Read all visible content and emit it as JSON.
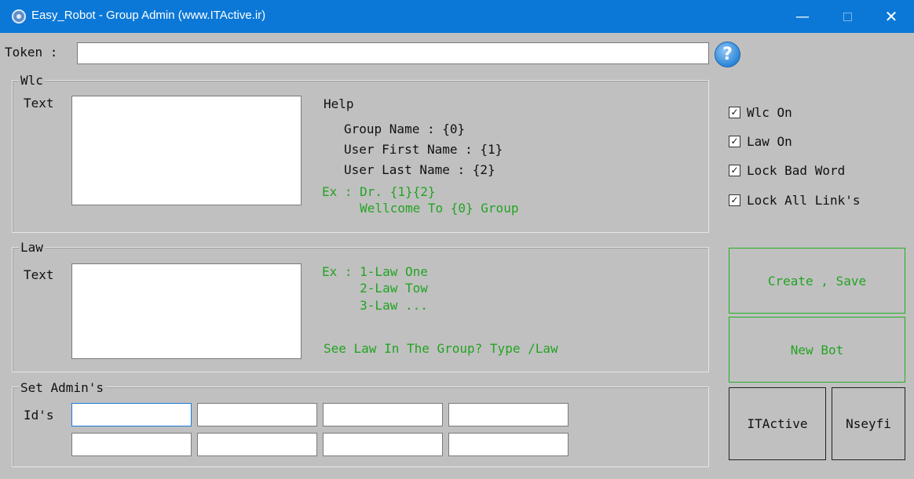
{
  "window": {
    "title": "Easy_Robot - Group Admin (www.ITActive.ir)",
    "minimize": "—",
    "close": "✕"
  },
  "token": {
    "label": "Token :",
    "value": ""
  },
  "help_button": "?",
  "wlc": {
    "title": "Wlc",
    "text_label": "Text",
    "text_value": "",
    "help_title": "Help",
    "help_lines": [
      "Group Name : {0}",
      "User First Name : {1}",
      "User Last Name : {2}"
    ],
    "example_lines": [
      "Ex : Dr. {1}{2}",
      "     Wellcome To {0} Group"
    ]
  },
  "law": {
    "title": "Law",
    "text_label": "Text",
    "text_value": "",
    "example_lines": [
      "Ex : 1-Law One",
      "     2-Law Tow",
      "     3-Law ..."
    ],
    "hint": "See Law In The Group? Type /Law"
  },
  "admins": {
    "title": "Set Admin's",
    "ids_label": "Id's",
    "ids": [
      "",
      "",
      "",
      "",
      "",
      "",
      "",
      ""
    ]
  },
  "options": [
    {
      "label": "Wlc On",
      "checked": true
    },
    {
      "label": "Law On",
      "checked": true
    },
    {
      "label": "Lock Bad Word",
      "checked": true
    },
    {
      "label": "Lock All Link's",
      "checked": true
    }
  ],
  "buttons": {
    "create_save": "Create , Save",
    "new_bot": "New Bot",
    "itactive": "ITActive",
    "nseyfi": "Nseyfi"
  },
  "colors": {
    "titlebar": "#0b78d7",
    "background": "#c0c0c0",
    "accent_green": "#22a422"
  }
}
